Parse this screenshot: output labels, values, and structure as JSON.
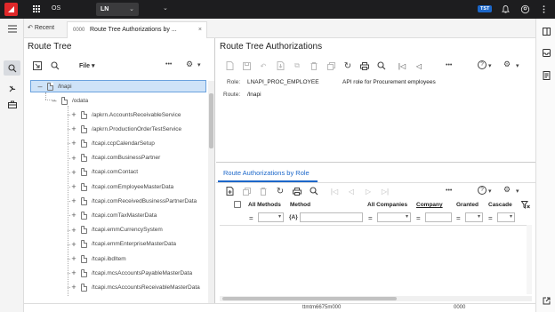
{
  "topbar": {
    "app_label": "OS",
    "module_button": "LN",
    "module_caret": "⌄",
    "caret_extra": "⌄",
    "env_badge": "TST"
  },
  "tabs": {
    "recent_label": "Recent",
    "active_code": "0000",
    "active_name": "Route Tree Authorizations by ...",
    "close_glyph": "×"
  },
  "tree": {
    "title": "Route Tree",
    "file_menu": "File",
    "root": "/lnapi",
    "child": "/odata",
    "items": [
      "/apkrn.AccountsReceivableService",
      "/apkrn.ProductionOrderTestService",
      "/tcapi.ccpCalendarSetup",
      "/tcapi.comBusinessPartner",
      "/tcapi.comContact",
      "/tcapi.comEmployeeMasterData",
      "/tcapi.comReceivedBusinessPartnerData",
      "/tcapi.comTaxMasterData",
      "/tcapi.emmCurrencySystem",
      "/tcapi.emmEnterpriseMasterData",
      "/tcapi.ibdItem",
      "/tcapi.mcsAccountsPayableMasterData",
      "/tcapi.mcsAccountsReceivableMasterData"
    ]
  },
  "auth": {
    "title": "Route Tree Authorizations",
    "role_label": "Role:",
    "role_value": "LNAPI_PROC_EMPLOYEE",
    "role_desc": "API role for Procurement employees",
    "route_label": "Route:",
    "route_value": "/lnapi"
  },
  "sub": {
    "tab_label": "Route Authorizations by Role",
    "columns": [
      "All Methods",
      "Method",
      "All Companies",
      "Company",
      "Granted",
      "Cascade"
    ],
    "method_filter_glyph": "{A}"
  },
  "status": {
    "left": "ttmtm6675m000",
    "right": "0000"
  },
  "icons": {
    "recent": "↶",
    "overflow": "•••",
    "help": "?",
    "settings": "⚙",
    "caret": "▾",
    "search": "⌕",
    "first": "|◁",
    "prev": "◁",
    "next": "▷",
    "last": "▷|",
    "refresh": "↻",
    "print": "⎙",
    "delete": "🗑",
    "copy": "⧉",
    "undo": "↶",
    "save": "💾",
    "new": "📄"
  }
}
